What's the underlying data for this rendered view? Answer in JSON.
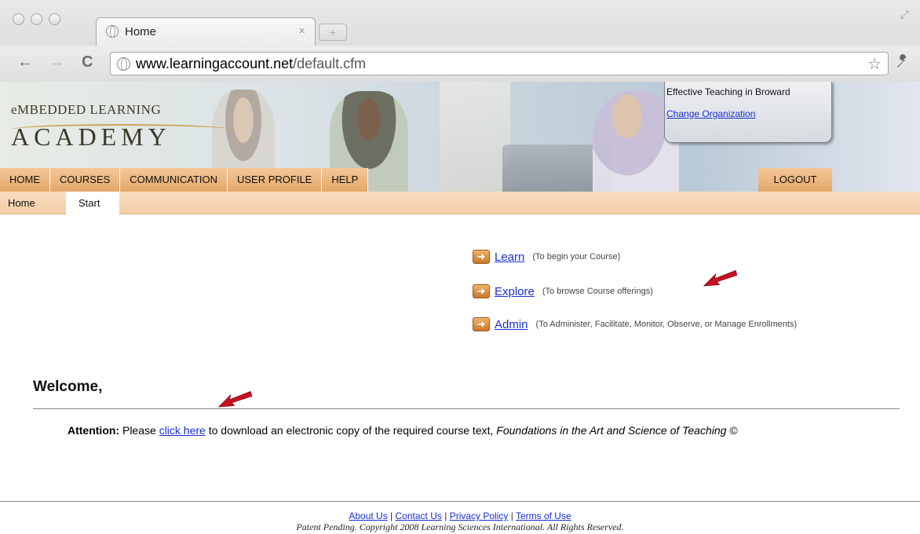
{
  "browser": {
    "tab_title": "Home",
    "tab_close": "×",
    "new_tab": "+",
    "url_domain": "www.learningaccount.net",
    "url_path": "/default.cfm",
    "back": "←",
    "forward": "→",
    "reload": "C",
    "star": "☆",
    "wrench": "🔧"
  },
  "header": {
    "logo_line1": "eMBEDDED LEARNING",
    "logo_line2": "ACADEMY",
    "organization": "Effective Teaching in Broward",
    "change_org": "Change Organization"
  },
  "main_nav": [
    "HOME",
    "COURSES",
    "COMMUNICATION",
    "USER PROFILE",
    "HELP"
  ],
  "logout": "LOGOUT",
  "sub_nav": {
    "home": "Home",
    "start": "Start"
  },
  "actions": [
    {
      "label": "Learn",
      "desc": "(To begin your Course)"
    },
    {
      "label": "Explore",
      "desc": "(To browse Course offerings)"
    },
    {
      "label": "Admin",
      "desc": "(To Administer, Facilitate, Monitor, Observe, or Manage Enrollments)"
    }
  ],
  "welcome": "Welcome,",
  "attention": {
    "label": "Attention:",
    "before": "Please",
    "link": "click here",
    "after": "to download an electronic copy of the required course text,",
    "book": "Foundations in the Art and Science of Teaching",
    "symbol": "©"
  },
  "footer": {
    "links": [
      "About Us",
      "Contact Us",
      "Privacy Policy",
      "Terms of Use"
    ],
    "separator": "|",
    "copyright": "Patent Pending. Copyright 2008 Learning Sciences International. All Rights Reserved."
  },
  "colors": {
    "nav_orange": "#e4a669",
    "link_blue": "#1a2ed6",
    "annotation_red": "#c8101e"
  }
}
